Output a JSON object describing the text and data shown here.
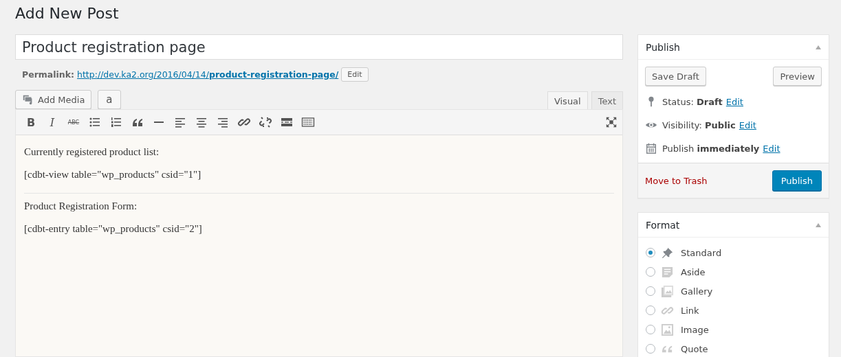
{
  "heading": "Add New Post",
  "title_field": {
    "value": "Product registration page"
  },
  "permalink": {
    "label": "Permalink:",
    "url": "http://dev.ka2.org/2016/04/14/**product-registration-page/**",
    "edit": "Edit"
  },
  "media_buttons": [
    {
      "kind": "add-media",
      "label": "Add Media"
    },
    {
      "kind": "amazon",
      "label": "a"
    }
  ],
  "editor_tabs": [
    {
      "label": "Visual",
      "selected": true
    },
    {
      "label": "Text",
      "selected": false
    }
  ],
  "toolbar": [
    {
      "kind": "bold",
      "glyph": "B"
    },
    {
      "kind": "italic",
      "glyph": "I"
    },
    {
      "kind": "strike",
      "glyph": "ABC"
    },
    {
      "kind": "bullets"
    },
    {
      "kind": "numbers"
    },
    {
      "kind": "quote"
    },
    {
      "kind": "hr"
    },
    {
      "kind": "align-left"
    },
    {
      "kind": "align-center"
    },
    {
      "kind": "align-right"
    },
    {
      "kind": "link"
    },
    {
      "kind": "unlink"
    },
    {
      "kind": "more"
    },
    {
      "kind": "kitchen"
    }
  ],
  "content": [
    {
      "kind": "para",
      "text": "Currently registered product list:"
    },
    {
      "kind": "para",
      "text": "[cdbt-view table=\"wp_products\" csid=\"1\"]"
    },
    {
      "kind": "rule"
    },
    {
      "kind": "para",
      "text": "Product Registration Form:"
    },
    {
      "kind": "para",
      "text": "[cdbt-entry table=\"wp_products\" csid=\"2\"]"
    }
  ],
  "publish_box": {
    "title": "Publish",
    "save_draft": "Save Draft",
    "preview": "Preview",
    "rows": [
      {
        "kind": "status",
        "text": "Status: **Draft**",
        "edit": "Edit"
      },
      {
        "kind": "visibility",
        "text": "Visibility: **Public**",
        "edit": "Edit"
      },
      {
        "kind": "schedule",
        "text": "Publish **immediately**",
        "edit": "Edit"
      }
    ],
    "trash": "Move to Trash",
    "publish": "Publish"
  },
  "format_box": {
    "title": "Format",
    "options": [
      {
        "kind": "standard",
        "label": "Standard",
        "selected": true
      },
      {
        "kind": "aside",
        "label": "Aside",
        "selected": false
      },
      {
        "kind": "gallery",
        "label": "Gallery",
        "selected": false
      },
      {
        "kind": "link",
        "label": "Link",
        "selected": false
      },
      {
        "kind": "image",
        "label": "Image",
        "selected": false
      },
      {
        "kind": "quote",
        "label": "Quote",
        "selected": false
      }
    ]
  }
}
